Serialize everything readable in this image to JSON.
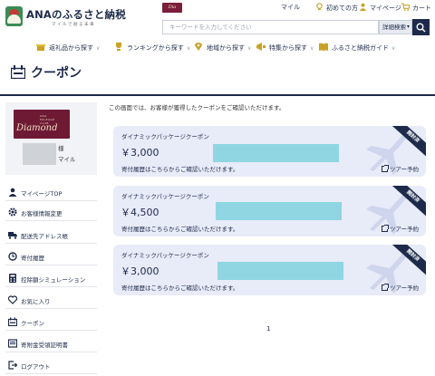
{
  "header": {
    "logo_text": "ANAのふるさと納税",
    "logo_sub": "マイルで創る未来",
    "badge_text": "Dia",
    "search_placeholder": "キーワードを入力してください",
    "search_detail": "詳細検索",
    "links": {
      "mile": "マイル",
      "first_time": "初めての方",
      "mypage": "マイページ",
      "cart": "カート"
    }
  },
  "nav": {
    "items": [
      {
        "label": "返礼品から探す",
        "icon": "gift-icon"
      },
      {
        "label": "ランキングから探す",
        "icon": "trophy-icon"
      },
      {
        "label": "地域から探す",
        "icon": "map-pin-icon"
      },
      {
        "label": "特集から探す",
        "icon": "feature-icon"
      },
      {
        "label": "ふるさと納税ガイド",
        "icon": "book-icon"
      }
    ]
  },
  "page": {
    "title": "クーポン",
    "intro": "この画面では、お客様が獲得したクーポンをご確認いただけます。"
  },
  "profile": {
    "card_small": "ANA\nMILEAGE\nCLUB",
    "card_main": "Diamond",
    "honorific": "様",
    "mile_suffix": "マイル"
  },
  "sidebar": {
    "items": [
      {
        "label": "マイページTOP",
        "icon": "user-icon"
      },
      {
        "label": "お客様情報変更",
        "icon": "gear-icon"
      },
      {
        "label": "配送先アドレス帳",
        "icon": "truck-icon"
      },
      {
        "label": "寄付履歴",
        "icon": "history-icon"
      },
      {
        "label": "控除額シミュレーション",
        "icon": "calculator-icon"
      },
      {
        "label": "お気に入り",
        "icon": "heart-icon"
      },
      {
        "label": "クーポン",
        "icon": "coupon-icon"
      },
      {
        "label": "寄附金受領証明書",
        "icon": "document-icon"
      },
      {
        "label": "ログアウト",
        "icon": "logout-icon"
      }
    ]
  },
  "coupons": [
    {
      "name": "ダイナミックパッケージクーポン",
      "amount": "￥3,000",
      "note": "寄付履歴はこちらからご確認いただけます。",
      "ribbon": "開封済",
      "tour": "ツアー予約"
    },
    {
      "name": "ダイナミックパッケージクーポン",
      "amount": "￥4,500",
      "note": "寄付履歴はこちらからご確認いただけます。",
      "ribbon": "開封済",
      "tour": "ツアー予約"
    },
    {
      "name": "ダイナミックパッケージクーポン",
      "amount": "￥3,000",
      "note": "寄付履歴はこちらからご確認いただけます。",
      "ribbon": "開封済",
      "tour": "ツアー予約"
    }
  ],
  "pager": {
    "current": "1"
  },
  "colors": {
    "navy": "#1d2a4a",
    "coupon_bg": "#e8ebf8",
    "mask": "#8fd6e2",
    "diamond": "#6e1a34"
  }
}
